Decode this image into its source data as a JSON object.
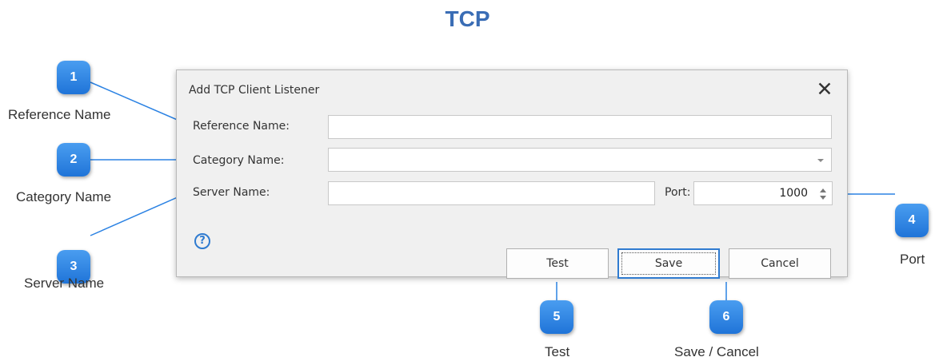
{
  "page_title": "TCP",
  "dialog": {
    "title": "Add TCP Client Listener",
    "close_symbol": "✕",
    "reference_name_label": "Reference Name:",
    "reference_name_value": "",
    "category_name_label": "Category Name:",
    "category_name_value": "",
    "server_name_label": "Server Name:",
    "server_name_value": "",
    "port_label": "Port:",
    "port_value": "1000",
    "help_symbol": "?",
    "buttons": {
      "test": "Test",
      "save": "Save",
      "cancel": "Cancel"
    }
  },
  "callouts": [
    {
      "number": "1",
      "label": "Reference Name"
    },
    {
      "number": "2",
      "label": "Category Name"
    },
    {
      "number": "3",
      "label": "Server Name"
    },
    {
      "number": "4",
      "label": "Port"
    },
    {
      "number": "5",
      "label": "Test"
    },
    {
      "number": "6",
      "label": "Save / Cancel"
    }
  ],
  "colors": {
    "title": "#3a6db5",
    "badge": "#2b82e3",
    "connector": "#2b82e3",
    "focus": "#2f7bd0"
  },
  "icons": {
    "close": "close-icon",
    "help": "help-icon",
    "combo": "chevron-down-icon",
    "spin": "spin-arrows-icon"
  }
}
